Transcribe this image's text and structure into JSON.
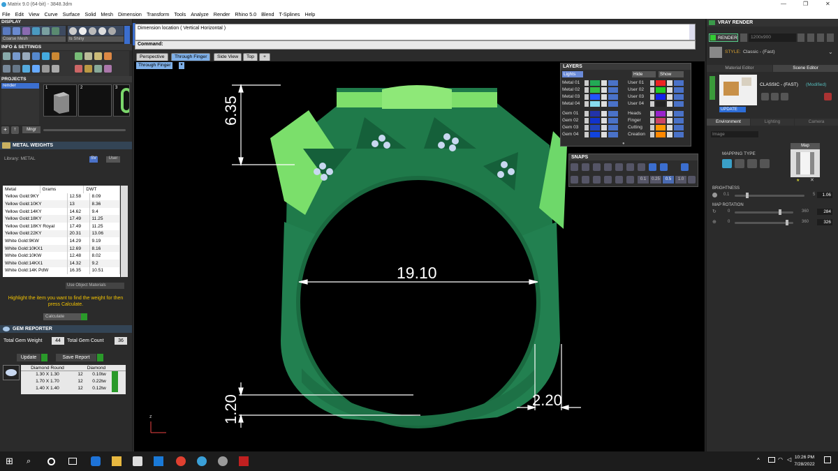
{
  "window": {
    "title": "Matrix 9.0 (64-bit) - 3848.3dm"
  },
  "menu": [
    "File",
    "Edit",
    "View",
    "Curve",
    "Surface",
    "Solid",
    "Mesh",
    "Dimension",
    "Transform",
    "Tools",
    "Analyze",
    "Render",
    "Rhino 5.0",
    "Blend",
    "T-Splines",
    "Help"
  ],
  "left": {
    "display_title": "DISPLAY",
    "display_mode": "Coarse Mesh",
    "display_style": "Is Shiny",
    "info_title": "INFO & SETTINGS",
    "projects_title": "PROJECTS",
    "project_item": "render",
    "project_slots": [
      "1",
      "2",
      "3"
    ],
    "mngr_label": "Mngr",
    "metal_title": "METAL WEIGHTS",
    "library_label": "Library: METAL",
    "sv_label": "SV",
    "user_label": "User",
    "metal_headers": [
      "Metal",
      "Grams",
      "DWT"
    ],
    "metals": [
      [
        "Yellow Gold:9KY",
        "12.58",
        "8.09"
      ],
      [
        "Yellow Gold:10KY",
        "13",
        "8.36"
      ],
      [
        "Yellow Gold:14KY",
        "14.62",
        "9.4"
      ],
      [
        "Yellow Gold:18KY",
        "17.49",
        "11.25"
      ],
      [
        "Yellow Gold:18KY Royal",
        "17.49",
        "11.25"
      ],
      [
        "Yellow Gold:22KY",
        "20.31",
        "13.06"
      ],
      [
        "White Gold:9KW",
        "14.29",
        "9.19"
      ],
      [
        "White Gold:10KX1",
        "12.69",
        "8.16"
      ],
      [
        "White Gold:10KW",
        "12.48",
        "8.02"
      ],
      [
        "White Gold:14KX1",
        "14.32",
        "9.2"
      ],
      [
        "White Gold:14K PdW",
        "16.35",
        "10.51"
      ]
    ],
    "use_object_materials": "Use Object Materials",
    "hint": "Highlight the item you want to find the weight for then press Calculate.",
    "calculate": "Calculate",
    "gem_title": "GEM REPORTER",
    "total_gem_weight_label": "Total Gem Weight",
    "total_gem_weight": "44",
    "total_gem_count_label": "Total Gem Count",
    "total_gem_count": "36",
    "update": "Update",
    "save_report": "Save Report",
    "gem_headers": [
      "Diamond Round",
      "Diamond"
    ],
    "gems": [
      [
        "1.30 X 1.30",
        "12",
        "0.10tw"
      ],
      [
        "1.70 X 1.70",
        "12",
        "0.22tw"
      ],
      [
        "1.40 X 1.40",
        "12",
        "0.12tw"
      ]
    ]
  },
  "center": {
    "prompt": "Dimension location ( Vertical  Horizontal )",
    "command_label": "Command:",
    "tabs": [
      "Perspective",
      "Through Finger",
      "Side View",
      "Top"
    ],
    "active_tab": "Through Finger",
    "viewport_label": "Through Finger",
    "dims": {
      "top_height": "6.35",
      "inner_diameter": "19.10",
      "width_bottom": "2.20",
      "height_bottom": "1.20"
    },
    "axis_label": "z"
  },
  "layers": {
    "title": "LAYERS",
    "lights": "Lights",
    "hide": "Hide",
    "show": "Show",
    "left_rows": [
      "Metal 01",
      "Metal 02",
      "Metal 03",
      "Metal 04",
      "Gem 01",
      "Gem 02",
      "Gem 03",
      "Gem 04"
    ],
    "left_colors": [
      "#22aa55",
      "#33bb44",
      "#2255ff",
      "#88ddee",
      "#2233aa",
      "#1133cc",
      "#2244bb",
      "#1144dd"
    ],
    "right_rows": [
      "User 01",
      "User 02",
      "User 03",
      "User 04",
      "Heads",
      "Finger",
      "Cutting",
      "Creation"
    ],
    "right_colors": [
      "#ee2222",
      "#22cc22",
      "#1122ee",
      "#222222",
      "#9922cc",
      "#cc4466",
      "#ff9900",
      "#ff8800"
    ]
  },
  "snaps": {
    "title": "SNAPS",
    "values": [
      "0.1",
      "0.25",
      "0.5",
      "1.0"
    ]
  },
  "right": {
    "title": "VRAY RENDER",
    "render_btn": "RENDER",
    "resolution": "1200x900",
    "style_label": "STYLE:",
    "style_value": "Classic - (Fast)",
    "tab_material": "Material Editor",
    "tab_scene": "Scene Editor",
    "scene_name": "CLASSIC - (FAST)",
    "scene_mod": "(Modified)",
    "update": "UPDATE",
    "env_tabs": [
      "Environment",
      "Lighting",
      "Camera"
    ],
    "env_select": "Image",
    "map_label": "Map",
    "mapping_type": "MAPPING TYPE",
    "brightness_label": "BRIGHTNESS",
    "brightness_min": "0.1",
    "brightness_max": "5",
    "brightness_value": "1.06",
    "rotation_label": "MAP ROTATION",
    "rot1_min": "0",
    "rot1_max": "360",
    "rot1_value": "284",
    "rot2_min": "0",
    "rot2_max": "360",
    "rot2_value": "326"
  },
  "taskbar": {
    "time": "10:26 PM",
    "date": "7/28/2022"
  }
}
